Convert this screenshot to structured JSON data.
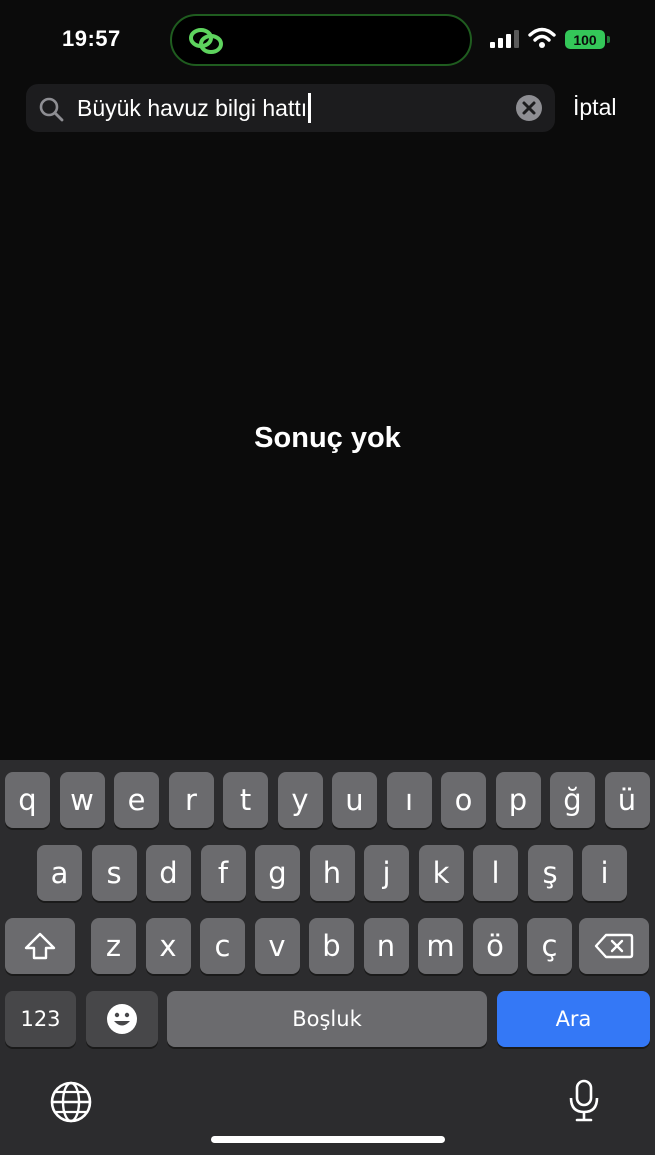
{
  "status": {
    "time": "19:57",
    "battery": "100"
  },
  "search": {
    "query": "Büyük havuz bilgi hattı",
    "cancel_label": "İptal"
  },
  "results": {
    "empty_message": "Sonuç yok"
  },
  "keyboard": {
    "row1": [
      "q",
      "w",
      "e",
      "r",
      "t",
      "y",
      "u",
      "ı",
      "o",
      "p",
      "ğ",
      "ü"
    ],
    "row2": [
      "a",
      "s",
      "d",
      "f",
      "g",
      "h",
      "j",
      "k",
      "l",
      "ş",
      "i"
    ],
    "row3": [
      "z",
      "x",
      "c",
      "v",
      "b",
      "n",
      "m",
      "ö",
      "ç"
    ],
    "numbers_label": "123",
    "space_label": "Boşluk",
    "return_label": "Ara"
  },
  "colors": {
    "accent": "#3478f6",
    "battery": "#34c759"
  }
}
